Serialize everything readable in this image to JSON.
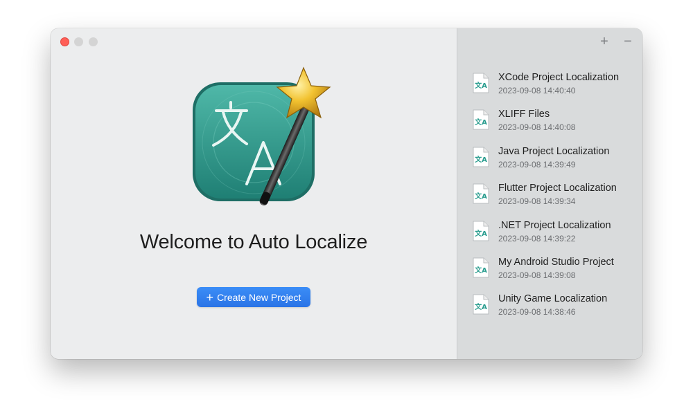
{
  "window": {
    "traffic_lights": [
      "close",
      "minimize",
      "zoom"
    ]
  },
  "welcome": {
    "title": "Welcome to Auto Localize",
    "app_icon": "translate-magic-wand-icon",
    "create_button": {
      "icon": "plus-icon",
      "label": "Create New Project"
    }
  },
  "sidebar": {
    "add_button": "+",
    "remove_button": "−",
    "recent_projects": [
      {
        "name": "XCode Project Localization",
        "date": "2023-09-08 14:40:40"
      },
      {
        "name": "XLIFF Files",
        "date": "2023-09-08 14:40:08"
      },
      {
        "name": "Java Project Localization",
        "date": "2023-09-08 14:39:49"
      },
      {
        "name": "Flutter Project Localization",
        "date": "2023-09-08 14:39:34"
      },
      {
        "name": ".NET Project Localization",
        "date": "2023-09-08 14:39:22"
      },
      {
        "name": "My Android Studio Project",
        "date": "2023-09-08 14:39:08"
      },
      {
        "name": "Unity Game Localization",
        "date": "2023-09-08 14:38:46"
      }
    ]
  },
  "colors": {
    "accent": "#2f7ff0",
    "icon_teal": "#2a9d8f",
    "close_red": "#ff5f57",
    "sidebar_bg": "#d9dbdc",
    "window_bg": "#ecedee"
  }
}
